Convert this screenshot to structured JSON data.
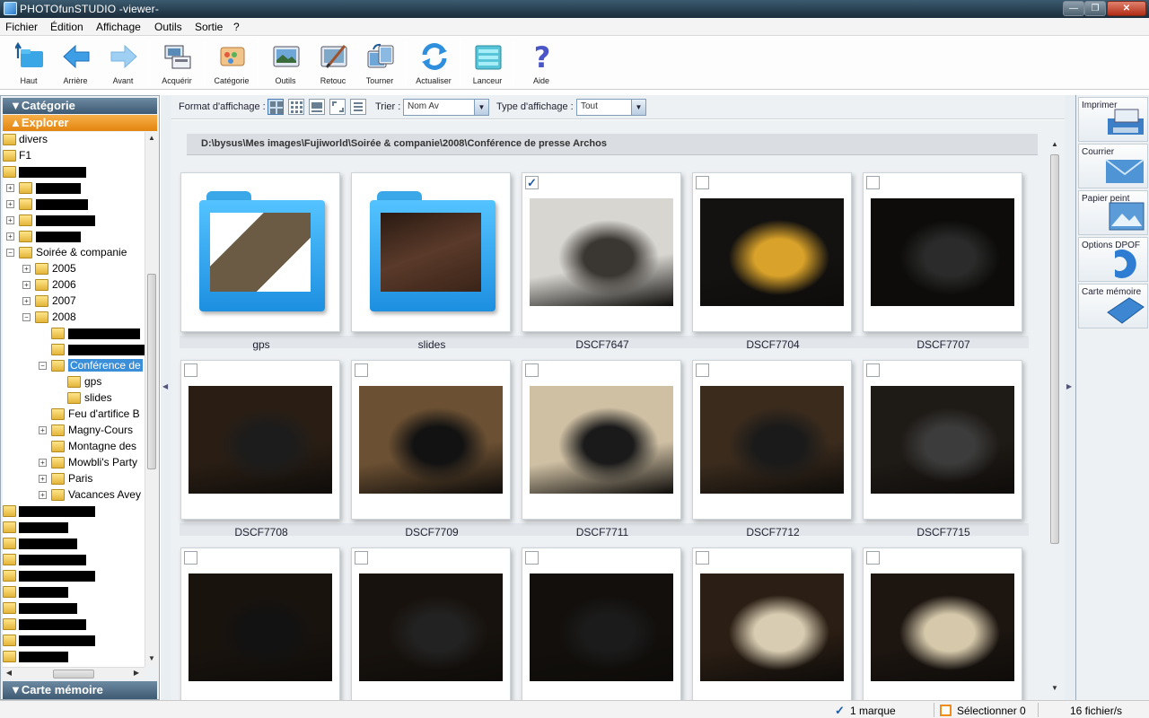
{
  "window": {
    "title": "PHOTOfunSTUDIO -viewer-",
    "controls": {
      "minimize": "—",
      "maximize": "❐",
      "close": "✕"
    }
  },
  "menu": [
    "Fichier",
    "Édition",
    "Affichage",
    "Outils",
    "Sortie",
    "?"
  ],
  "toolbar": {
    "buttons": [
      {
        "label": "Haut",
        "icon": "folder-up-icon"
      },
      {
        "label": "Arrière",
        "icon": "arrow-left-icon"
      },
      {
        "label": "Avant",
        "icon": "arrow-right-icon"
      },
      {
        "label": "Acquérir",
        "icon": "acquire-icon"
      },
      {
        "label": "Catégorie",
        "icon": "category-icon"
      },
      {
        "label": "Outils",
        "icon": "tools-icon"
      },
      {
        "label": "Retouc",
        "icon": "retouch-icon"
      },
      {
        "label": "Tourner",
        "icon": "rotate-icon"
      },
      {
        "label": "Actualiser",
        "icon": "refresh-icon"
      },
      {
        "label": "Lanceur",
        "icon": "launcher-icon"
      },
      {
        "label": "Aide",
        "icon": "help-icon"
      }
    ]
  },
  "left_panel": {
    "category_header": "▼Catégorie",
    "explorer_header": "▲Explorer",
    "memory_card_header": "▼Carte mémoire",
    "tree": [
      {
        "label": "divers",
        "level": 0,
        "expander": ""
      },
      {
        "label": "F1",
        "level": 0,
        "expander": ""
      },
      {
        "label": "",
        "level": 0,
        "expander": "",
        "redacted": true
      },
      {
        "label": "",
        "level": 1,
        "expander": "+",
        "redacted": true
      },
      {
        "label": "",
        "level": 1,
        "expander": "+",
        "redacted": true
      },
      {
        "label": "",
        "level": 1,
        "expander": "+",
        "redacted": true
      },
      {
        "label": "",
        "level": 1,
        "expander": "+",
        "redacted": true
      },
      {
        "label": "Soirée & companie",
        "level": 1,
        "expander": "−"
      },
      {
        "label": "2005",
        "level": 2,
        "expander": "+"
      },
      {
        "label": "2006",
        "level": 2,
        "expander": "+"
      },
      {
        "label": "2007",
        "level": 2,
        "expander": "+"
      },
      {
        "label": "2008",
        "level": 2,
        "expander": "−"
      },
      {
        "label": "",
        "level": 3,
        "expander": "",
        "redacted": true
      },
      {
        "label": "",
        "level": 3,
        "expander": "",
        "redacted": true
      },
      {
        "label": "Conférence de",
        "level": 3,
        "expander": "−",
        "selected": true
      },
      {
        "label": "gps",
        "level": 4,
        "expander": ""
      },
      {
        "label": "slides",
        "level": 4,
        "expander": ""
      },
      {
        "label": "Feu d'artifice B",
        "level": 3,
        "expander": ""
      },
      {
        "label": "Magny-Cours",
        "level": 3,
        "expander": "+"
      },
      {
        "label": "Montagne des",
        "level": 3,
        "expander": ""
      },
      {
        "label": "Mowbli's Party",
        "level": 3,
        "expander": "+"
      },
      {
        "label": "Paris",
        "level": 3,
        "expander": "+"
      },
      {
        "label": "Vacances Avey",
        "level": 3,
        "expander": "+"
      },
      {
        "label": "",
        "level": 0,
        "expander": "",
        "redacted": true
      },
      {
        "label": "",
        "level": 0,
        "expander": "",
        "redacted": true
      },
      {
        "label": "",
        "level": 0,
        "expander": "",
        "redacted": true
      },
      {
        "label": "",
        "level": 0,
        "expander": "",
        "redacted": true
      },
      {
        "label": "",
        "level": 0,
        "expander": "",
        "redacted": true
      },
      {
        "label": "",
        "level": 0,
        "expander": "",
        "redacted": true
      },
      {
        "label": "",
        "level": 0,
        "expander": "",
        "redacted": true
      },
      {
        "label": "",
        "level": 0,
        "expander": "",
        "redacted": true
      },
      {
        "label": "",
        "level": 0,
        "expander": "",
        "redacted": true
      },
      {
        "label": "",
        "level": 0,
        "expander": "",
        "redacted": true
      }
    ]
  },
  "viewbar": {
    "format_label": "Format d'affichage :",
    "sort_label": "Trier :",
    "sort_value": "Nom Av",
    "type_label": "Type d'affichage :",
    "type_value": "Tout"
  },
  "content": {
    "path": "D:\\bysus\\Mes images\\Fujiworld\\Soirée & companie\\2008\\Conférence de presse Archos",
    "items": [
      {
        "name": "gps",
        "kind": "folder",
        "checked": false
      },
      {
        "name": "slides",
        "kind": "folder",
        "checked": false
      },
      {
        "name": "DSCF7647",
        "kind": "photo",
        "checked": true,
        "palette": [
          "#d8d6d0",
          "#3a3632"
        ]
      },
      {
        "name": "DSCF7704",
        "kind": "photo",
        "checked": false,
        "palette": [
          "#141210",
          "#d9a22a"
        ]
      },
      {
        "name": "DSCF7707",
        "kind": "photo",
        "checked": false,
        "palette": [
          "#0d0c0b",
          "#2a2b2a"
        ]
      },
      {
        "name": "DSCF7708",
        "kind": "photo",
        "checked": false,
        "palette": [
          "#2a1e14",
          "#1c1c1c"
        ]
      },
      {
        "name": "DSCF7709",
        "kind": "photo",
        "checked": false,
        "palette": [
          "#6b5033",
          "#121212"
        ]
      },
      {
        "name": "DSCF7711",
        "kind": "photo",
        "checked": false,
        "palette": [
          "#cfc0a4",
          "#1a1a1a"
        ]
      },
      {
        "name": "DSCF7712",
        "kind": "photo",
        "checked": false,
        "palette": [
          "#3a2b1d",
          "#1a1a1a"
        ]
      },
      {
        "name": "DSCF7715",
        "kind": "photo",
        "checked": false,
        "palette": [
          "#1e1a16",
          "#3c3c3c"
        ]
      },
      {
        "name": "",
        "kind": "photo",
        "checked": false,
        "palette": [
          "#19130e",
          "#121212"
        ]
      },
      {
        "name": "",
        "kind": "photo",
        "checked": false,
        "palette": [
          "#17120d",
          "#222"
        ]
      },
      {
        "name": "",
        "kind": "photo",
        "checked": false,
        "palette": [
          "#120f0c",
          "#1b1b1b"
        ]
      },
      {
        "name": "",
        "kind": "photo",
        "checked": false,
        "palette": [
          "#2b1e14",
          "#d8cdb2"
        ]
      },
      {
        "name": "",
        "kind": "photo",
        "checked": false,
        "palette": [
          "#1c1510",
          "#d6c9ab"
        ]
      }
    ]
  },
  "right_panel": {
    "buttons": [
      "Imprimer",
      "Courrier",
      "Papier peint",
      "Options DPOF",
      "Carte mémoire"
    ]
  },
  "statusbar": {
    "marked": "1 marque",
    "select": "Sélectionner 0",
    "files": "16 fichier/s"
  },
  "colors": {
    "accent_orange": "#e3850f",
    "panel_blue": "#3e5a72",
    "check_blue": "#1c5aa8"
  }
}
